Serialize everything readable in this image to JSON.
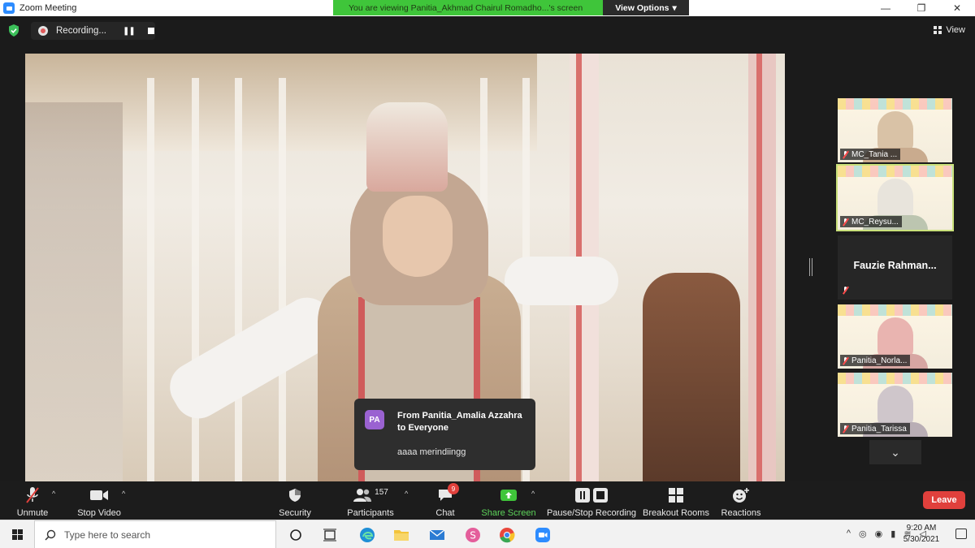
{
  "window": {
    "title": "Zoom Meeting",
    "minimize": "—",
    "maximize": "❐",
    "close": "✕"
  },
  "banner": {
    "viewing": "You are viewing Panitia_Akhmad Chairul Romadho...'s screen",
    "view_options": "View Options",
    "view_options_caret": "▾"
  },
  "recording": {
    "label": "Recording...",
    "pause": "❚❚"
  },
  "top_right": {
    "view_label": "View"
  },
  "chat_notification": {
    "avatar": "PA",
    "from": "From Panitia_Amalia Azzahra to Everyone",
    "message": "aaaa merindiingg"
  },
  "gallery": {
    "tiles": [
      {
        "name": "MC_Tania ...",
        "muted": true
      },
      {
        "name": "MC_Reysu...",
        "muted": true,
        "active": true
      },
      {
        "name": "Fauzie Rahman...",
        "muted": true,
        "video": false
      },
      {
        "name": "Panitia_Norla...",
        "muted": true
      },
      {
        "name": "Panitia_Tarissa",
        "muted": true
      }
    ],
    "more": "⌄"
  },
  "toolbar": {
    "unmute": "Unmute",
    "stop_video": "Stop Video",
    "security": "Security",
    "participants": "Participants",
    "participants_count": "157",
    "chat": "Chat",
    "chat_badge": "9",
    "share_screen": "Share Screen",
    "pause_stop_recording": "Pause/Stop Recording",
    "breakout_rooms": "Breakout Rooms",
    "reactions": "Reactions",
    "leave": "Leave",
    "caret": "^"
  },
  "taskbar": {
    "search_placeholder": "Type here to search",
    "time": "9:20 AM",
    "date": "5/30/2021",
    "tray_caret": "^"
  },
  "colors": {
    "share_green": "#5dd35a",
    "leave_red": "#e0403c",
    "banner_green": "#3fc53a",
    "avatar_purple": "#9a62d1"
  }
}
